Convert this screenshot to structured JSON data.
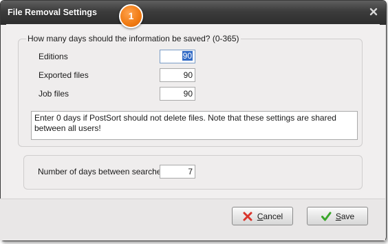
{
  "window": {
    "title": "File Removal Settings",
    "step_badge": "1"
  },
  "retention": {
    "legend": "How many days should the information be saved? (0-365)",
    "rows": [
      {
        "label": "Editions",
        "value": "90"
      },
      {
        "label": "Exported files",
        "value": "90"
      },
      {
        "label": "Job files",
        "value": "90"
      }
    ],
    "note": "Enter 0 days if PostSort should not delete files. Note that these settings are shared between all users!"
  },
  "search": {
    "label": "Number of days between searches?",
    "value": "7"
  },
  "buttons": {
    "cancel_mnemonic": "C",
    "cancel_rest": "ancel",
    "save_mnemonic": "S",
    "save_rest": "ave"
  },
  "icons": {
    "close": "close-icon",
    "cancel": "red-x-icon",
    "save": "green-check-icon"
  },
  "colors": {
    "titlebar": "#3c3c3c",
    "badge": "#f07a12",
    "selection": "#316ac5",
    "cancel_icon": "#d9342b",
    "save_icon": "#3aa62b"
  }
}
